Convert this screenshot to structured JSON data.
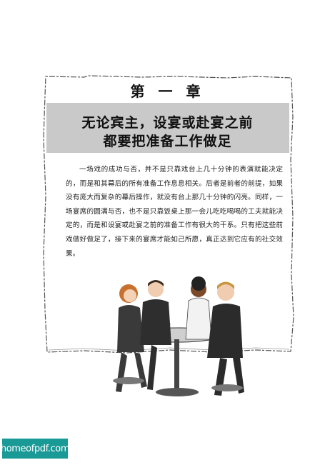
{
  "chapter_heading": "第 一 章",
  "title": {
    "line1": "无论宾主，设宴或赴宴之前",
    "line2": "都要把准备工作做足"
  },
  "paragraph": "一场戏的成功与否，并不是只靠戏台上几十分钟的表演就能决定的，而是和其幕后的所有准备工作息息相关。后者是前者的前提，如果没有庞大而复杂的幕后操作，就没有台上那几十分钟的闪亮。同样，一场宴席的圆满与否，也不是只靠饭桌上那一会儿吃吃喝喝的工夫就能决定的，而是和设宴或赴宴之前的准备工作有很大的干系。只有把这些前戏做好做足了，接下来的宴席才能如己所愿，真正达到它应有的社交效果。",
  "watermark": "homeofpdf.com",
  "colors": {
    "banner": "#c9c9c9",
    "watermark_bg": "#1a9a96",
    "frame_stroke": "#555555"
  },
  "illustration": "four-people-at-cafe-table"
}
